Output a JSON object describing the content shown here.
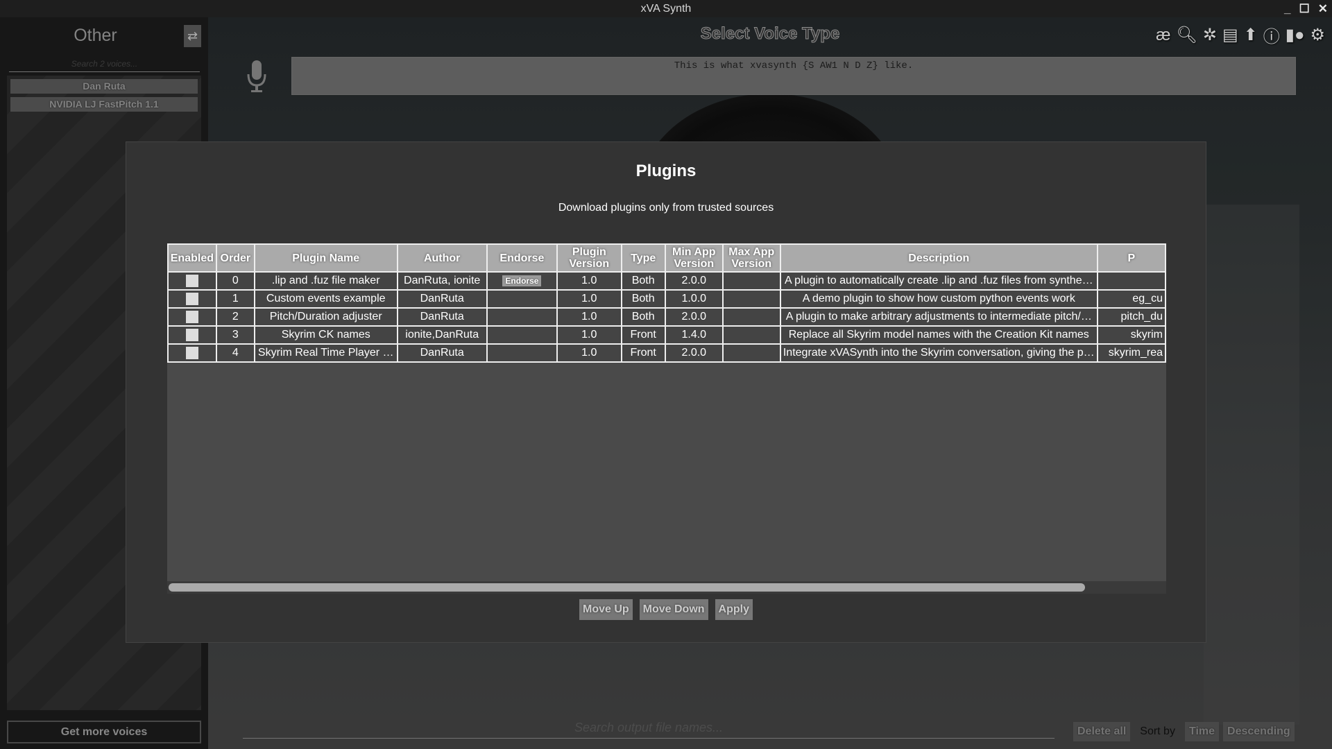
{
  "window": {
    "title": "xVA Synth",
    "controls": {
      "minimize": "_",
      "maximize": "☐",
      "close": "✕"
    }
  },
  "sidebar": {
    "title": "Other",
    "swap_icon": "⇄",
    "search_placeholder": "Search 2 voices...",
    "voices": [
      "Dan Ruta",
      "NVIDIA LJ FastPitch 1.1"
    ],
    "get_more_label": "Get more voices"
  },
  "main": {
    "title": "Select Voice Type",
    "toolbar": [
      {
        "name": "arpabet-icon",
        "glyph": "æ"
      },
      {
        "name": "search-icon",
        "glyph": "🔍︎"
      },
      {
        "name": "plugins-icon",
        "glyph": "✲"
      },
      {
        "name": "batch-icon",
        "glyph": "▤"
      },
      {
        "name": "update-icon",
        "glyph": "⬆"
      },
      {
        "name": "info-icon",
        "glyph": "ⓘ"
      },
      {
        "name": "nexus-icon",
        "glyph": "▮●"
      },
      {
        "name": "settings-icon",
        "glyph": "⚙"
      }
    ],
    "prompt_text": "This is what xvasynth {S AW1 N D Z} like.",
    "output_search_placeholder": "Search output file names...",
    "delete_all_label": "Delete all",
    "sort_by_label": "Sort by",
    "sort_field": "Time",
    "sort_order": "Descending"
  },
  "modal": {
    "title": "Plugins",
    "subtitle": "Download plugins only from trusted sources",
    "columns": [
      "Enabled",
      "Order",
      "Plugin Name",
      "Author",
      "Endorse",
      "Plugin Version",
      "Type",
      "Min App Version",
      "Max App Version",
      "Description",
      "P"
    ],
    "rows": [
      {
        "enabled": false,
        "order": "0",
        "name": ".lip and .fuz file maker",
        "author": "DanRuta, ionite",
        "endorse": "Endorse",
        "version": "1.0",
        "type": "Both",
        "min_app": "2.0.0",
        "max_app": "",
        "description": "A plugin to automatically create .lip and .fuz files from synthe…",
        "plugin_id": ""
      },
      {
        "enabled": false,
        "order": "1",
        "name": "Custom events example",
        "author": "DanRuta",
        "endorse": "",
        "version": "1.0",
        "type": "Both",
        "min_app": "1.0.0",
        "max_app": "",
        "description": "A demo plugin to show how custom python events work",
        "plugin_id": "eg_cu"
      },
      {
        "enabled": false,
        "order": "2",
        "name": "Pitch/Duration adjuster",
        "author": "DanRuta",
        "endorse": "",
        "version": "1.0",
        "type": "Both",
        "min_app": "2.0.0",
        "max_app": "",
        "description": "A plugin to make arbitrary adjustments to intermediate pitch/…",
        "plugin_id": "pitch_du"
      },
      {
        "enabled": false,
        "order": "3",
        "name": "Skyrim CK names",
        "author": "ionite,DanRuta",
        "endorse": "",
        "version": "1.0",
        "type": "Front",
        "min_app": "1.4.0",
        "max_app": "",
        "description": "Replace all Skyrim model names with the Creation Kit names",
        "plugin_id": "skyrim"
      },
      {
        "enabled": false,
        "order": "4",
        "name": "Skyrim Real Time Player …",
        "author": "DanRuta",
        "endorse": "",
        "version": "1.0",
        "type": "Front",
        "min_app": "2.0.0",
        "max_app": "",
        "description": "Integrate xVASynth into the Skyrim conversation, giving the p…",
        "plugin_id": "skyrim_rea"
      }
    ],
    "scroll_position_fraction": 0.92,
    "buttons": {
      "move_up": "Move Up",
      "move_down": "Move Down",
      "apply": "Apply"
    }
  }
}
